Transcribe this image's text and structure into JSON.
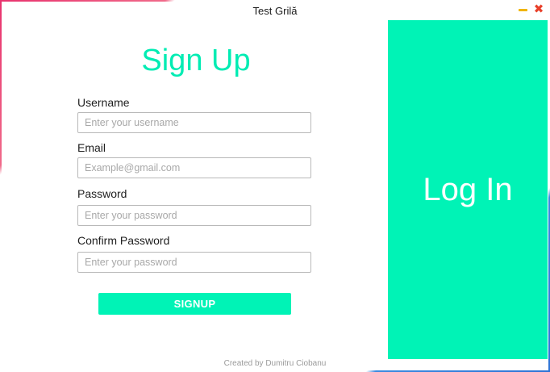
{
  "window": {
    "title": "Test Grilă",
    "minimize_icon": "minimize-icon",
    "close_icon": "close-icon",
    "close_glyph": "✖"
  },
  "form": {
    "heading": "Sign Up",
    "username": {
      "label": "Username",
      "placeholder": "Enter your username",
      "value": ""
    },
    "email": {
      "label": "Email",
      "placeholder": "Example@gmail.com",
      "value": ""
    },
    "password": {
      "label": "Password",
      "placeholder": "Enter your password",
      "value": ""
    },
    "confirm_password": {
      "label": "Confirm Password",
      "placeholder": "Enter your password",
      "value": ""
    },
    "signup_label": "SIGNUP"
  },
  "login_panel": {
    "label": "Log In"
  },
  "footer": {
    "credit": "Created by Dumitru Ciobanu"
  },
  "colors": {
    "accent": "#00f3b6",
    "heading": "#00ecb3",
    "close": "#e8402a",
    "minimize": "#f0b400"
  }
}
